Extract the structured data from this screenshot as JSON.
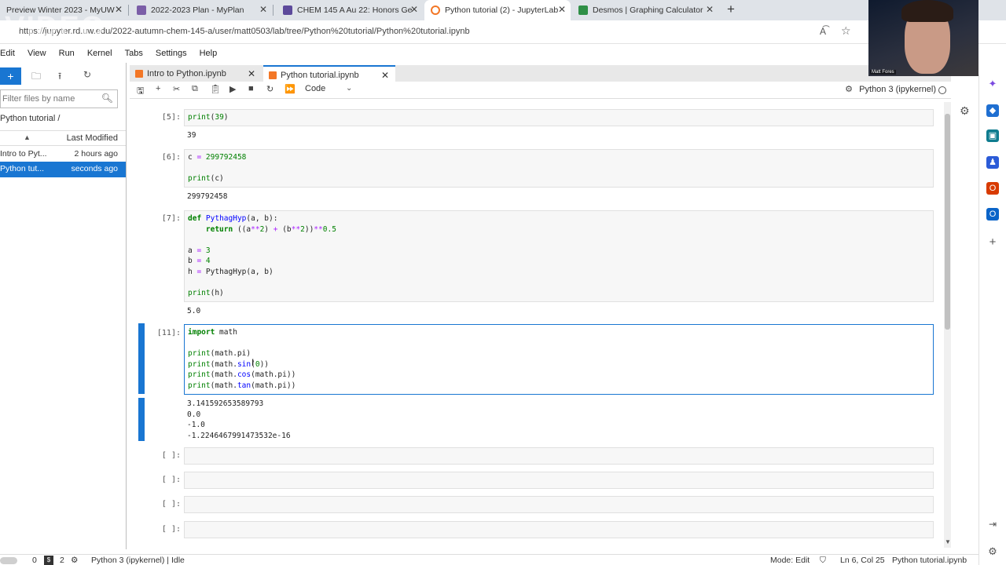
{
  "browser": {
    "tabs": [
      {
        "title": "Preview Winter 2023 - MyUW",
        "active": false,
        "favicon_color": "#4b2e83"
      },
      {
        "title": "2022-2023 Plan - MyPlan",
        "active": false,
        "favicon_color": "#7b5ea7"
      },
      {
        "title": "CHEM 145 A Au 22: Honors Gen",
        "active": false,
        "favicon_color": "#5d4a9b"
      },
      {
        "title": "Python tutorial (2) - JupyterLab",
        "active": true,
        "favicon_color": "#f37726"
      },
      {
        "title": "Desmos | Graphing Calculator",
        "active": false,
        "favicon_color": "#2f8f46"
      }
    ],
    "url": "https://jupyter.rd.uw.edu/2022-autumn-chem-145-a/user/matt0503/lab/tree/Python%20tutorial/Python%20tutorial.ipynb",
    "watermark": "VIDEO"
  },
  "jupyter": {
    "menu": [
      "Edit",
      "View",
      "Run",
      "Kernel",
      "Tabs",
      "Settings",
      "Help"
    ],
    "filebrowser": {
      "filter_placeholder": "Filter files by name",
      "path": "Python tutorial /",
      "header_modified": "Last Modified",
      "files": [
        {
          "name": "Intro to Pyt...",
          "modified": "2 hours ago",
          "selected": false
        },
        {
          "name": "Python tut...",
          "modified": "seconds ago",
          "selected": true
        }
      ]
    },
    "doc_tabs": [
      {
        "label": "Intro to Python.ipynb",
        "active": false
      },
      {
        "label": "Python tutorial.ipynb",
        "active": true
      }
    ],
    "toolbar": {
      "cell_type": "Code",
      "kernel": "Python 3 (ipykernel)"
    },
    "cells": [
      {
        "prompt": "[5]:",
        "output": "39"
      },
      {
        "prompt": "[6]:",
        "output": "299792458"
      },
      {
        "prompt": "[7]:",
        "output": "5.0"
      },
      {
        "prompt": "[11]:",
        "output": "3.141592653589793\n0.0\n-1.0\n-1.2246467991473532e-16"
      },
      {
        "prompt": "[ ]:"
      },
      {
        "prompt": "[ ]:"
      },
      {
        "prompt": "[ ]:"
      },
      {
        "prompt": "[ ]:"
      }
    ],
    "statusbar": {
      "terminals": "0",
      "kernels": "2",
      "kernel_state": "Python 3 (ipykernel) | Idle",
      "mode": "Mode: Edit",
      "position": "Ln 6, Col 25",
      "filename": "Python tutorial.ipynb"
    }
  },
  "webcam": {
    "name": "Matt Fores"
  },
  "colors": {
    "accent": "#1976d2",
    "tabstrip": "#dfe3e8",
    "jupyter_orange": "#f37726"
  }
}
